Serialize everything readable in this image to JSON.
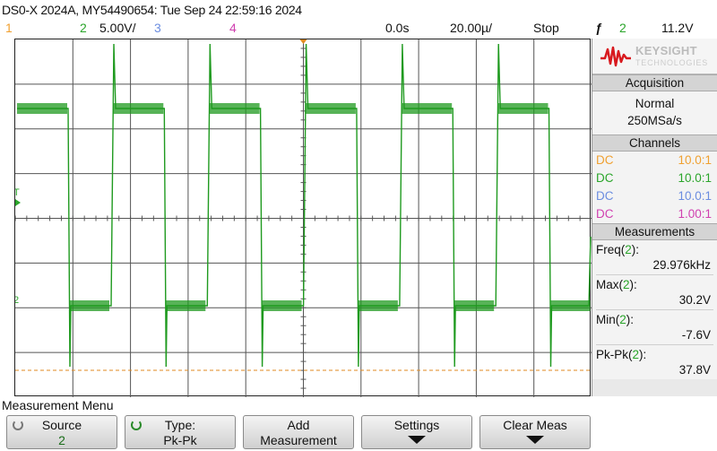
{
  "header": {
    "title": "DS0-X 2024A, MY54490654: Tue Sep 24 22:59:16 2024",
    "ch1_label": "1",
    "ch2_label": "2",
    "ch2_scale": "5.00V/",
    "ch3_label": "3",
    "ch4_label": "4",
    "time_position": "0.0s",
    "time_scale": "20.00µ/",
    "run_state": "Stop",
    "trigger_symbol": "ƒ",
    "trigger_source": "2",
    "trigger_level": "11.2V"
  },
  "colors": {
    "ch1": "#f0a030",
    "ch2": "#2aa52a",
    "ch3": "#6b8de0",
    "ch4": "#d040b0",
    "trace": "#1f9a1f",
    "marker": "#e08a20"
  },
  "side": {
    "brand": "KEYSIGHT",
    "brand_sub": "TECHNOLOGIES",
    "acq_title": "Acquisition",
    "acq_mode": "Normal",
    "acq_rate": "250MSa/s",
    "channels_title": "Channels",
    "channels": [
      {
        "coupling": "DC",
        "probe": "10.0:1"
      },
      {
        "coupling": "DC",
        "probe": "10.0:1"
      },
      {
        "coupling": "DC",
        "probe": "10.0:1"
      },
      {
        "coupling": "DC",
        "probe": "1.00:1"
      }
    ],
    "meas_title": "Measurements",
    "measurements": [
      {
        "name": "Freq",
        "src": "2",
        "value": "29.976kHz"
      },
      {
        "name": "Max",
        "src": "2",
        "value": "30.2V"
      },
      {
        "name": "Min",
        "src": "2",
        "value": "-7.6V"
      },
      {
        "name": "Pk-Pk",
        "src": "2",
        "value": "37.8V"
      }
    ]
  },
  "menu": {
    "title": "Measurement Menu",
    "source_label": "Source",
    "source_value": "2",
    "type_label": "Type:",
    "type_value": "Pk-Pk",
    "add_line1": "Add",
    "add_line2": "Measurement",
    "settings_label": "Settings",
    "clear_label": "Clear Meas"
  }
}
